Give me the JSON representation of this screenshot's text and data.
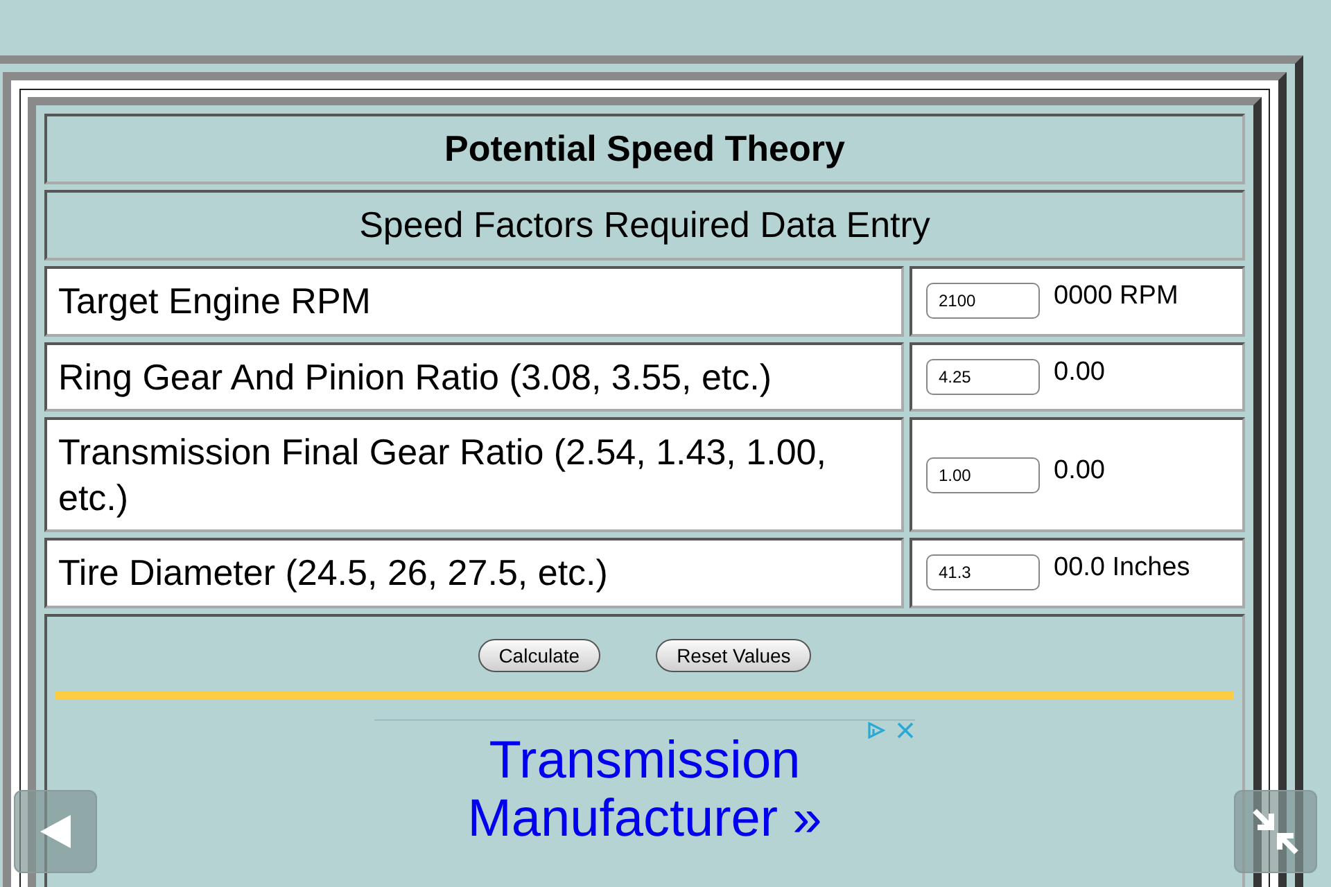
{
  "title": "Potential Speed Theory",
  "subtitle": "Speed Factors Required Data Entry",
  "fields": [
    {
      "label": "Target Engine RPM",
      "value": "2100",
      "result": "0000 RPM"
    },
    {
      "label": "Ring Gear And Pinion Ratio (3.08, 3.55, etc.)",
      "value": "4.25",
      "result": "0.00"
    },
    {
      "label": "Transmission Final Gear Ratio (2.54, 1.43, 1.00, etc.)",
      "value": "1.00",
      "result": "0.00"
    },
    {
      "label": "Tire Diameter (24.5, 26, 27.5, etc.)",
      "value": "41.3",
      "result": "00.0 Inches"
    }
  ],
  "buttons": [
    "Calculate",
    "Reset Values"
  ],
  "ad": {
    "link": "Transmission Manufacturer »"
  }
}
